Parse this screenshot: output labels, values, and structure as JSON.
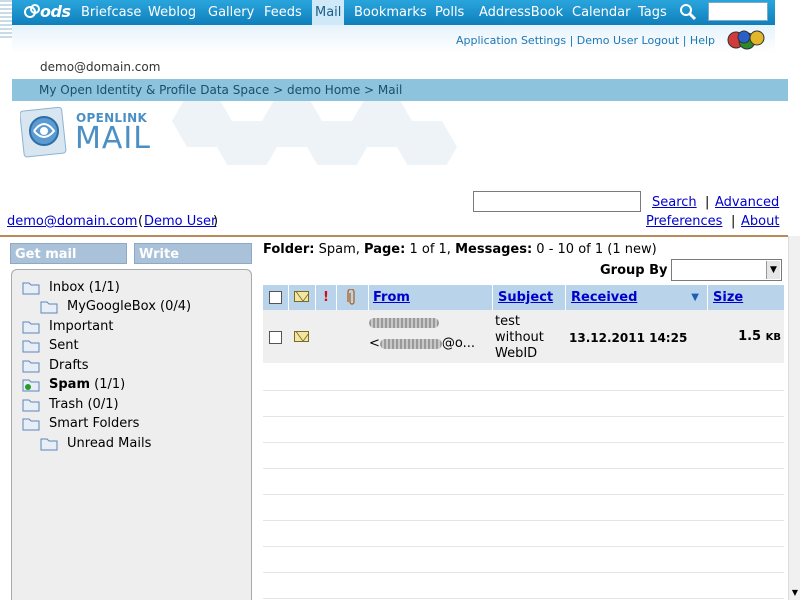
{
  "nav": {
    "logo": "ods",
    "items": [
      "Briefcase",
      "Weblog",
      "Gallery",
      "Feeds",
      "Mail",
      "Bookmarks",
      "Polls",
      "AddressBook",
      "Calendar",
      "Tags"
    ],
    "active": "Mail"
  },
  "header_links": {
    "settings": "Application Settings",
    "logout": "Demo User Logout",
    "help": "Help",
    "separator": "|"
  },
  "user_email": "demo@domain.com",
  "breadcrumb": "My Open Identity & Profile Data Space > demo Home > Mail",
  "banner": {
    "small": "OPENLINK",
    "big": "MAIL"
  },
  "search": {
    "search_link": "Search",
    "advanced_link": "Advanced",
    "separator": "|"
  },
  "user": {
    "email_link": "demo@domain.com",
    "name_link": "Demo User",
    "open_paren": "(",
    "close_paren": ")"
  },
  "top_right_links": {
    "preferences": "Preferences",
    "about": "About",
    "separator": "|"
  },
  "sidebar": {
    "get_mail": "Get mail",
    "write": "Write",
    "folders": [
      {
        "label": "Inbox (1/1)",
        "bold": false,
        "indent": false
      },
      {
        "label": "MyGoogleBox (0/4)",
        "bold": false,
        "indent": true
      },
      {
        "label": "Important",
        "bold": false,
        "indent": false
      },
      {
        "label": "Sent",
        "bold": false,
        "indent": false
      },
      {
        "label": "Drafts",
        "bold": false,
        "indent": false
      },
      {
        "label": "Spam",
        "count": "(1/1)",
        "bold": true,
        "indent": false
      },
      {
        "label": "Trash (0/1)",
        "bold": false,
        "indent": false
      },
      {
        "label": "Smart Folders",
        "bold": false,
        "indent": false
      },
      {
        "label": "Unread Mails",
        "bold": false,
        "indent": true
      }
    ]
  },
  "folder_info": {
    "folder_label": "Folder:",
    "folder_value": "Spam,",
    "page_label": "Page:",
    "page_value": "1 of 1,",
    "messages_label": "Messages:",
    "messages_value": "0 - 10 of 1 (1 new)"
  },
  "group_by": {
    "label": "Group By",
    "value": ""
  },
  "table": {
    "columns": [
      "From",
      "Subject",
      "Received",
      "Size"
    ],
    "priority_glyph": "!",
    "rows": [
      {
        "from_line1": "",
        "from_line2_start": "<",
        "from_line2_end": "@o...",
        "subject_lines": [
          "test",
          "without",
          "WebID"
        ],
        "received": "13.12.2011 14:25",
        "size": "1.5",
        "size_unit": "KB"
      }
    ]
  },
  "colors": {
    "nav_bg": "#1a8fcb",
    "breadcrumb_bg": "#8dc3dd",
    "table_header_bg": "#b9d3ea",
    "link": "#0000cc",
    "sidebar_button": "#a9c1d9"
  }
}
